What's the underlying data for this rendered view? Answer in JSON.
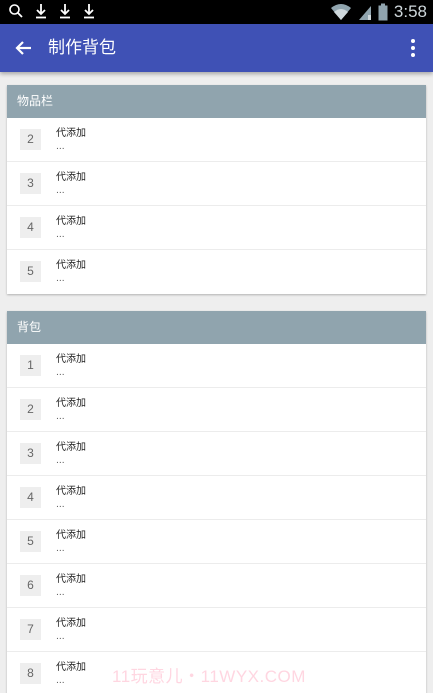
{
  "status_bar": {
    "time": "3:58",
    "icons": [
      "search-icon",
      "download-icon",
      "download-icon",
      "download-icon",
      "wifi-icon",
      "signal-icon",
      "battery-icon"
    ]
  },
  "app_bar": {
    "title": "制作背包",
    "back_icon": "arrow-back-icon",
    "menu_icon": "more-vert-icon",
    "color": "#3f51b5"
  },
  "inventory": {
    "title": "物品栏",
    "items": [
      {
        "slot": "2",
        "name": "代添加",
        "desc": "..."
      },
      {
        "slot": "3",
        "name": "代添加",
        "desc": "..."
      },
      {
        "slot": "4",
        "name": "代添加",
        "desc": "..."
      },
      {
        "slot": "5",
        "name": "代添加",
        "desc": "..."
      }
    ]
  },
  "backpack": {
    "title": "背包",
    "items": [
      {
        "slot": "1",
        "name": "代添加",
        "desc": "..."
      },
      {
        "slot": "2",
        "name": "代添加",
        "desc": "..."
      },
      {
        "slot": "3",
        "name": "代添加",
        "desc": "..."
      },
      {
        "slot": "4",
        "name": "代添加",
        "desc": "..."
      },
      {
        "slot": "5",
        "name": "代添加",
        "desc": "..."
      },
      {
        "slot": "6",
        "name": "代添加",
        "desc": "..."
      },
      {
        "slot": "7",
        "name": "代添加",
        "desc": "..."
      },
      {
        "slot": "8",
        "name": "代添加",
        "desc": "..."
      }
    ]
  },
  "watermark": "11玩意儿・11WYX.COM",
  "colors": {
    "header": "#90a4ae",
    "accent": "#3f51b5"
  }
}
